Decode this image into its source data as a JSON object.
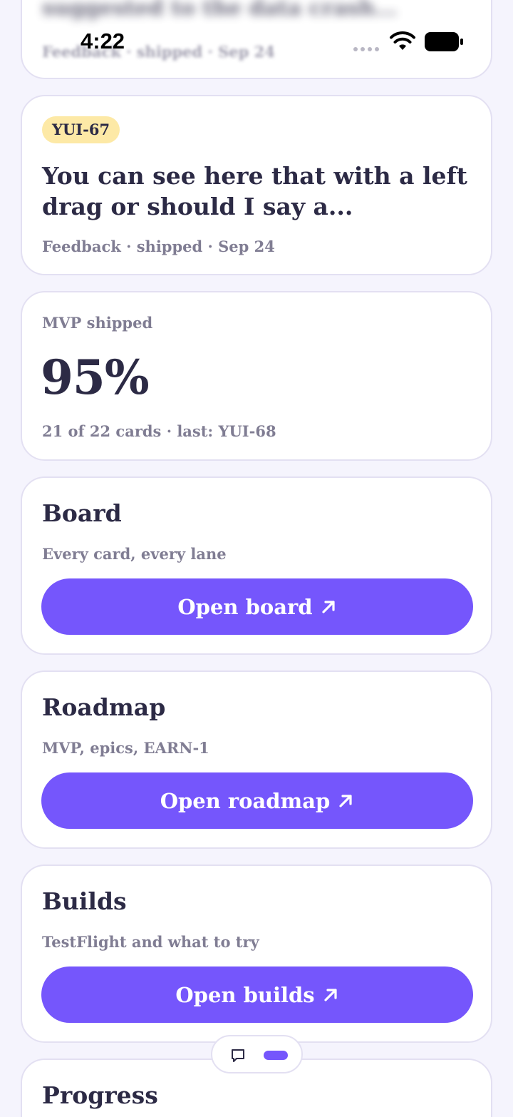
{
  "status_bar": {
    "time": "4:22"
  },
  "previous_card": {
    "title": "suggested to the data crash...",
    "meta": "Feedback · shipped · Sep 24"
  },
  "feature_card": {
    "badge": "YUI-67",
    "title": "You can see here that with a left drag or should I say a...",
    "meta": "Feedback · shipped · Sep 24"
  },
  "mvp_card": {
    "label": "MVP shipped",
    "percent": "95%",
    "meta": "21 of 22 cards · last: YUI-68"
  },
  "board_card": {
    "heading": "Board",
    "sub": "Every card, every lane",
    "button": "Open board"
  },
  "roadmap_card": {
    "heading": "Roadmap",
    "sub": "MVP, epics, EARN-1",
    "button": "Open roadmap"
  },
  "builds_card": {
    "heading": "Builds",
    "sub": "TestFlight and what to try",
    "button": "Open builds"
  },
  "progress_card": {
    "heading": "Progress"
  },
  "colors": {
    "accent": "#7556fc",
    "badge_bg": "#fde9a6",
    "background": "#f5f4fd",
    "text": "#2c2a45",
    "muted": "#807d93"
  },
  "icons": {
    "button_arrow": "arrow-up-right-icon",
    "pill_left": "chat-bubble-icon"
  }
}
